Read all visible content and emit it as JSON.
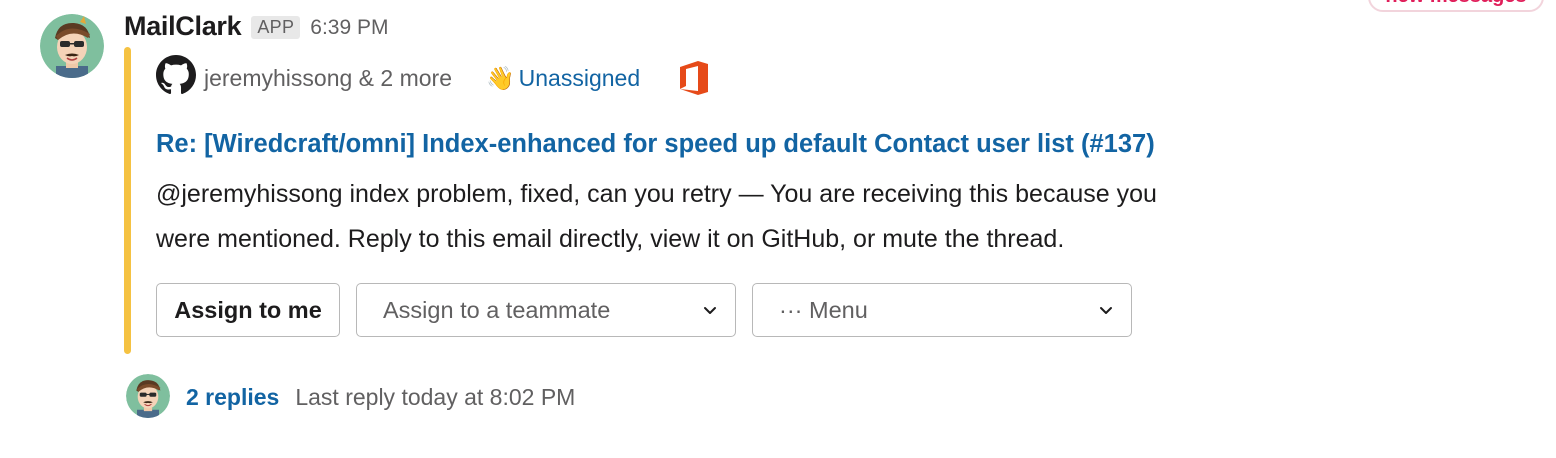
{
  "notification": {
    "new_messages_label": "new messages"
  },
  "message": {
    "sender": "MailClark",
    "badge": "APP",
    "time": "6:39 PM",
    "participants": "jeremyhissong & 2 more",
    "assignee_emoji": "👋",
    "assignee_status": "Unassigned",
    "subject": "Re: [Wiredcraft/omni] Index-enhanced for speed up default Contact user list (#137)",
    "body_line1": "@jeremyhissong index problem, fixed, can you retry — You are receiving this because you",
    "body_line2": "were mentioned. Reply to this email directly, view it on GitHub, or mute the thread.",
    "accent_color": "#f5c242",
    "link_color": "#1264a3"
  },
  "actions": {
    "assign_me_label": "Assign to me",
    "teammate_select_value": "Assign to a teammate",
    "menu_select_value": "··· Menu"
  },
  "thread": {
    "replies_label": "2 replies",
    "last_reply": "Last reply today at 8:02 PM"
  },
  "icons": {
    "participants": "github-icon",
    "source": "office-icon",
    "dropdown": "chevron-down-icon"
  }
}
